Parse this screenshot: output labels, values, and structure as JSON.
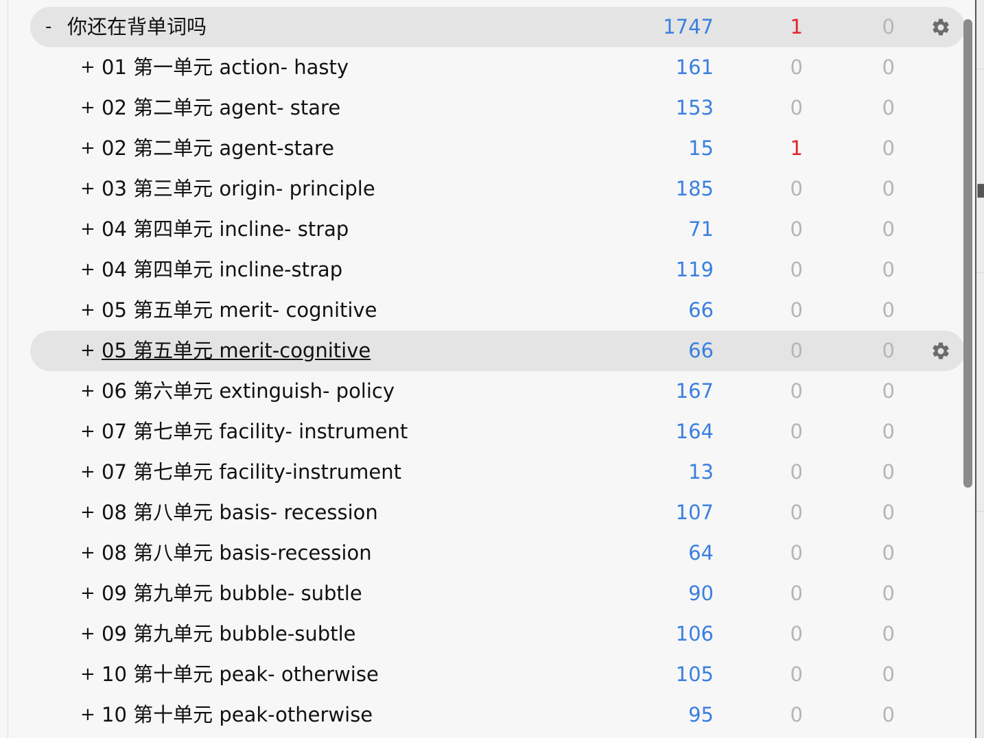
{
  "decks": [
    {
      "toggle": "-",
      "name": "你还在背单词吗",
      "new": "1747",
      "learn": "1",
      "due": "0",
      "level": 0,
      "current": true,
      "underlined": false,
      "learn_red": true
    },
    {
      "toggle": "+",
      "name": "01 第一单元 action- hasty",
      "new": "161",
      "learn": "0",
      "due": "0",
      "level": 1
    },
    {
      "toggle": "+",
      "name": "02 第二单元 agent- stare",
      "new": "153",
      "learn": "0",
      "due": "0",
      "level": 1
    },
    {
      "toggle": "+",
      "name": "02 第二单元 agent-stare",
      "new": "15",
      "learn": "1",
      "due": "0",
      "level": 1,
      "learn_red": true
    },
    {
      "toggle": "+",
      "name": "03 第三单元 origin- principle",
      "new": "185",
      "learn": "0",
      "due": "0",
      "level": 1
    },
    {
      "toggle": "+",
      "name": "04 第四单元 incline- strap",
      "new": "71",
      "learn": "0",
      "due": "0",
      "level": 1
    },
    {
      "toggle": "+",
      "name": "04 第四单元 incline-strap",
      "new": "119",
      "learn": "0",
      "due": "0",
      "level": 1
    },
    {
      "toggle": "+",
      "name": "05 第五单元 merit- cognitive",
      "new": "66",
      "learn": "0",
      "due": "0",
      "level": 1
    },
    {
      "toggle": "+",
      "name": "05 第五单元 merit-cognitive",
      "new": "66",
      "learn": "0",
      "due": "0",
      "level": 1,
      "current": true,
      "underlined": true
    },
    {
      "toggle": "+",
      "name": "06 第六单元 extinguish- policy",
      "new": "167",
      "learn": "0",
      "due": "0",
      "level": 1
    },
    {
      "toggle": "+",
      "name": "07 第七单元 facility- instrument",
      "new": "164",
      "learn": "0",
      "due": "0",
      "level": 1
    },
    {
      "toggle": "+",
      "name": "07 第七单元 facility-instrument",
      "new": "13",
      "learn": "0",
      "due": "0",
      "level": 1
    },
    {
      "toggle": "+",
      "name": "08 第八单元 basis- recession",
      "new": "107",
      "learn": "0",
      "due": "0",
      "level": 1
    },
    {
      "toggle": "+",
      "name": "08 第八单元 basis-recession",
      "new": "64",
      "learn": "0",
      "due": "0",
      "level": 1
    },
    {
      "toggle": "+",
      "name": "09 第九单元 bubble- subtle",
      "new": "90",
      "learn": "0",
      "due": "0",
      "level": 1
    },
    {
      "toggle": "+",
      "name": "09 第九单元 bubble-subtle",
      "new": "106",
      "learn": "0",
      "due": "0",
      "level": 1
    },
    {
      "toggle": "+",
      "name": "10 第十单元 peak- otherwise",
      "new": "105",
      "learn": "0",
      "due": "0",
      "level": 1
    },
    {
      "toggle": "+",
      "name": "10 第十单元 peak-otherwise",
      "new": "95",
      "learn": "0",
      "due": "0",
      "level": 1
    }
  ],
  "colors": {
    "new_count": "#3a7fe0",
    "learn_count_alert": "#e0262b",
    "zero_count": "#b5b5b5",
    "current_row_bg": "#e4e4e4"
  },
  "icons": {
    "options": "gear-icon"
  }
}
